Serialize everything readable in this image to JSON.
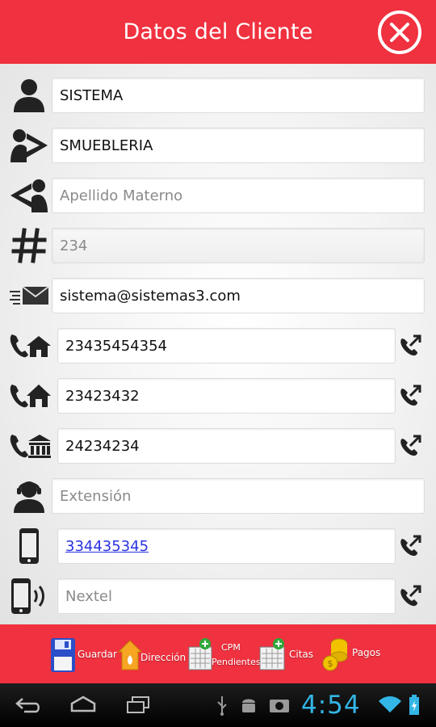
{
  "header": {
    "title": "Datos del Cliente"
  },
  "form": {
    "nombre": {
      "value": "SISTEMA"
    },
    "apellido_paterno": {
      "value": "SMUEBLERIA"
    },
    "apellido_materno": {
      "placeholder": "Apellido Materno"
    },
    "numero": {
      "value": "234"
    },
    "email": {
      "value": "sistema@sistemas3.com"
    },
    "tel_casa": {
      "value": "23435454354"
    },
    "tel_casa2": {
      "value": "23423432"
    },
    "tel_oficina": {
      "value": "24234234"
    },
    "extension": {
      "placeholder": "Extensión"
    },
    "celular": {
      "value": "334435345"
    },
    "nextel": {
      "placeholder": "Nextel"
    }
  },
  "toolbar": {
    "guardar": "Guardar",
    "direccion": "Dirección",
    "cpm_line1": "CPM",
    "cpm_line2": "Pendientes",
    "citas": "Citas",
    "pagos": "Pagos"
  },
  "status_bar": {
    "time": "4:54"
  },
  "colors": {
    "accent": "#f0313f",
    "clock": "#33b5e5",
    "link": "#2a33e0"
  }
}
